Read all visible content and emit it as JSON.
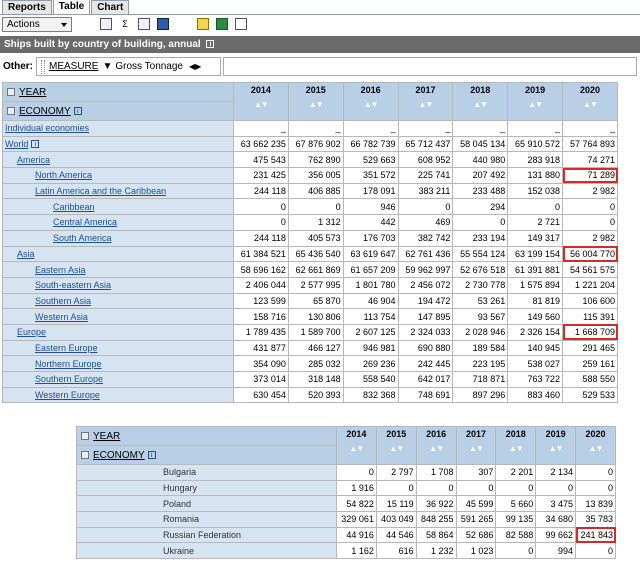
{
  "tabs": [
    "Reports",
    "Table",
    "Chart"
  ],
  "toolbar": {
    "actions_label": "Actions",
    "sum_glyph": "Σ"
  },
  "title": "Ships built by country of building, annual",
  "other": {
    "label": "Other:",
    "dimension": "MEASURE",
    "value": "Gross Tonnage"
  },
  "main_table": {
    "year_label": "YEAR",
    "economy_label": "ECONOMY",
    "years": [
      "2014",
      "2015",
      "2016",
      "2017",
      "2018",
      "2019",
      "2020"
    ],
    "rows": [
      {
        "label": "Individual economies",
        "indent": 0,
        "values": [
          "_",
          "_",
          "_",
          "_",
          "_",
          "_",
          "_"
        ]
      },
      {
        "label": "World",
        "indent": 0,
        "info": true,
        "values": [
          "63 662 235",
          "67 876 902",
          "66 782 739",
          "65 712 437",
          "58 045 134",
          "65 910 572",
          "57 764 893"
        ]
      },
      {
        "label": "America",
        "indent": 1,
        "values": [
          "475 543",
          "762 890",
          "529 663",
          "608 952",
          "440 980",
          "283 918",
          "74 271"
        ]
      },
      {
        "label": "North America",
        "indent": 2,
        "values": [
          "231 425",
          "356 005",
          "351 572",
          "225 741",
          "207 492",
          "131 880",
          "71 289"
        ],
        "highlight": 6
      },
      {
        "label": "Latin America and the Caribbean",
        "indent": 2,
        "values": [
          "244 118",
          "406 885",
          "178 091",
          "383 211",
          "233 488",
          "152 038",
          "2 982"
        ]
      },
      {
        "label": "Caribbean",
        "indent": 3,
        "values": [
          "0",
          "0",
          "946",
          "0",
          "294",
          "0",
          "0"
        ]
      },
      {
        "label": "Central America",
        "indent": 3,
        "values": [
          "0",
          "1 312",
          "442",
          "469",
          "0",
          "2 721",
          "0"
        ]
      },
      {
        "label": "South America",
        "indent": 3,
        "values": [
          "244 118",
          "405 573",
          "176 703",
          "382 742",
          "233 194",
          "149 317",
          "2 982"
        ]
      },
      {
        "label": "Asia",
        "indent": 1,
        "values": [
          "61 384 521",
          "65 436 540",
          "63 619 647",
          "62 761 436",
          "55 554 124",
          "63 199 154",
          "56 004 770"
        ],
        "highlight": 6
      },
      {
        "label": "Eastern Asia",
        "indent": 2,
        "values": [
          "58 696 162",
          "62 661 869",
          "61 657 209",
          "59 962 997",
          "52 676 518",
          "61 391 881",
          "54 561 575"
        ]
      },
      {
        "label": "South-eastern Asia",
        "indent": 2,
        "values": [
          "2 406 044",
          "2 577 995",
          "1 801 780",
          "2 456 072",
          "2 730 778",
          "1 575 894",
          "1 221 204"
        ]
      },
      {
        "label": "Southern Asia",
        "indent": 2,
        "values": [
          "123 599",
          "65 870",
          "46 904",
          "194 472",
          "53 261",
          "81 819",
          "106 600"
        ]
      },
      {
        "label": "Western Asia",
        "indent": 2,
        "values": [
          "158 716",
          "130 806",
          "113 754",
          "147 895",
          "93 567",
          "149 560",
          "115 391"
        ]
      },
      {
        "label": "Europe",
        "indent": 1,
        "values": [
          "1 789 435",
          "1 589 700",
          "2 607 125",
          "2 324 033",
          "2 028 946",
          "2 326 154",
          "1 668 709"
        ],
        "highlight": 6
      },
      {
        "label": "Eastern Europe",
        "indent": 2,
        "values": [
          "431 877",
          "466 127",
          "946 981",
          "690 880",
          "189 584",
          "140 945",
          "291 465"
        ]
      },
      {
        "label": "Northern Europe",
        "indent": 2,
        "values": [
          "354 090",
          "285 032",
          "269 236",
          "242 445",
          "223 195",
          "538 027",
          "259 161"
        ]
      },
      {
        "label": "Southern Europe",
        "indent": 2,
        "values": [
          "373 014",
          "318 148",
          "558 540",
          "642 017",
          "718 871",
          "763 722",
          "588 550"
        ]
      },
      {
        "label": "Western Europe",
        "indent": 2,
        "values": [
          "630 454",
          "520 393",
          "832 368",
          "748 691",
          "897 296",
          "883 460",
          "529 533"
        ]
      }
    ]
  },
  "sub_table": {
    "year_label": "YEAR",
    "economy_label": "ECONOMY",
    "years": [
      "2014",
      "2015",
      "2016",
      "2017",
      "2018",
      "2019",
      "2020"
    ],
    "rows": [
      {
        "label": "Bulgaria",
        "values": [
          "0",
          "2 797",
          "1 708",
          "307",
          "2 201",
          "2 134",
          "0"
        ]
      },
      {
        "label": "Hungary",
        "values": [
          "1 916",
          "0",
          "0",
          "0",
          "0",
          "0",
          "0"
        ]
      },
      {
        "label": "Poland",
        "values": [
          "54 822",
          "15 119",
          "36 922",
          "45 599",
          "5 660",
          "3 475",
          "13 839"
        ]
      },
      {
        "label": "Romania",
        "values": [
          "329 061",
          "403 049",
          "848 255",
          "591 265",
          "99 135",
          "34 680",
          "35 783"
        ]
      },
      {
        "label": "Russian Federation",
        "values": [
          "44 916",
          "44 546",
          "58 864",
          "52 686",
          "82 588",
          "99 662",
          "241 843"
        ],
        "highlight": 6
      },
      {
        "label": "Ukraine",
        "values": [
          "1 162",
          "616",
          "1 232",
          "1 023",
          "0",
          "994",
          "0"
        ]
      }
    ]
  }
}
